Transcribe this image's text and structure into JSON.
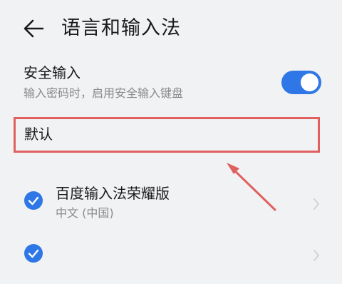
{
  "header": {
    "title": "语言和输入法"
  },
  "secure_input": {
    "title": "安全输入",
    "subtitle": "输入密码时，启用安全输入键盘",
    "enabled": true
  },
  "section": {
    "default_label": "默认"
  },
  "input_methods": [
    {
      "name": "百度输入法荣耀版",
      "language": "中文 (中国)",
      "checked": true
    },
    {
      "name": "",
      "language": "",
      "checked": true
    }
  ],
  "colors": {
    "accent": "#2f76e6",
    "annotation": "#e0605f",
    "background": "#f1f2f4"
  }
}
